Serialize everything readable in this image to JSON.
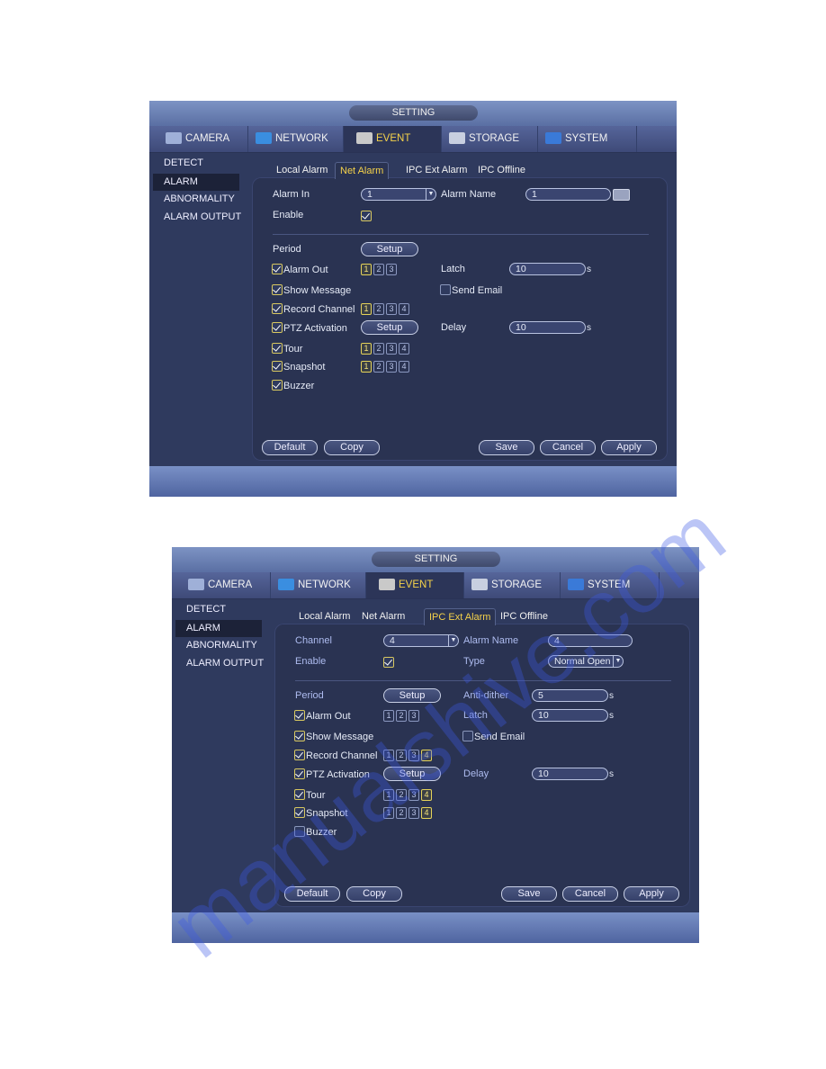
{
  "watermark": "manualshive.com",
  "colors": {
    "accent": "#f5d24a",
    "background": "#2f3a5e",
    "checkbox": "#d8c860"
  },
  "panels": [
    {
      "title": "SETTING",
      "tabs": [
        {
          "label": "CAMERA",
          "icon": "camera-icon"
        },
        {
          "label": "NETWORK",
          "icon": "network-icon"
        },
        {
          "label": "EVENT",
          "icon": "event-icon",
          "active": true
        },
        {
          "label": "STORAGE",
          "icon": "storage-icon"
        },
        {
          "label": "SYSTEM",
          "icon": "system-icon"
        }
      ],
      "sidebar": [
        {
          "label": "DETECT"
        },
        {
          "label": "ALARM",
          "active": true
        },
        {
          "label": "ABNORMALITY"
        },
        {
          "label": "ALARM OUTPUT"
        }
      ],
      "subtabs": [
        {
          "label": "Local Alarm"
        },
        {
          "label": "Net Alarm",
          "active": true
        },
        {
          "label": "IPC Ext Alarm"
        },
        {
          "label": "IPC Offline"
        }
      ],
      "rows": [
        {
          "left": {
            "label": "Alarm In",
            "control": {
              "kind": "select",
              "value": "1"
            }
          },
          "right": {
            "label": "Alarm Name",
            "control": {
              "kind": "input-icon",
              "value": "1"
            }
          }
        },
        {
          "left": {
            "label": "Enable",
            "control": {
              "kind": "checkbox",
              "checked": true
            }
          }
        },
        {
          "left": {
            "label": "Period",
            "control": {
              "kind": "button",
              "label": "Setup"
            }
          }
        },
        {
          "left": {
            "label": "Alarm Out",
            "checked": true,
            "control": {
              "kind": "channels",
              "items": [
                {
                  "n": "1",
                  "on": true
                },
                {
                  "n": "2"
                },
                {
                  "n": "3"
                }
              ]
            }
          },
          "right": {
            "label": "Latch",
            "control": {
              "kind": "input",
              "value": "10",
              "unit": "s"
            }
          }
        },
        {
          "left": {
            "label": "Show Message",
            "checked": true
          },
          "right": {
            "label": "Send Email",
            "checked": false
          }
        },
        {
          "left": {
            "label": "Record Channel",
            "checked": true,
            "control": {
              "kind": "channels",
              "items": [
                {
                  "n": "1",
                  "on": true
                },
                {
                  "n": "2"
                },
                {
                  "n": "3"
                },
                {
                  "n": "4"
                }
              ]
            }
          }
        },
        {
          "left": {
            "label": "PTZ Activation",
            "checked": true,
            "control": {
              "kind": "button",
              "label": "Setup"
            }
          },
          "right": {
            "label": "Delay",
            "control": {
              "kind": "input",
              "value": "10",
              "unit": "s"
            }
          }
        },
        {
          "left": {
            "label": "Tour",
            "checked": true,
            "control": {
              "kind": "channels",
              "items": [
                {
                  "n": "1",
                  "on": true
                },
                {
                  "n": "2"
                },
                {
                  "n": "3"
                },
                {
                  "n": "4"
                }
              ]
            }
          }
        },
        {
          "left": {
            "label": "Snapshot",
            "checked": true,
            "control": {
              "kind": "channels",
              "items": [
                {
                  "n": "1",
                  "on": true
                },
                {
                  "n": "2"
                },
                {
                  "n": "3"
                },
                {
                  "n": "4"
                }
              ]
            }
          }
        },
        {
          "left": {
            "label": "Buzzer",
            "checked": true
          }
        }
      ],
      "buttons": {
        "default": "Default",
        "copy": "Copy",
        "save": "Save",
        "cancel": "Cancel",
        "apply": "Apply"
      }
    },
    {
      "title": "SETTING",
      "tabs": [
        {
          "label": "CAMERA",
          "icon": "camera-icon"
        },
        {
          "label": "NETWORK",
          "icon": "network-icon"
        },
        {
          "label": "EVENT",
          "icon": "event-icon",
          "active": true
        },
        {
          "label": "STORAGE",
          "icon": "storage-icon"
        },
        {
          "label": "SYSTEM",
          "icon": "system-icon"
        }
      ],
      "sidebar": [
        {
          "label": "DETECT"
        },
        {
          "label": "ALARM",
          "active": true
        },
        {
          "label": "ABNORMALITY"
        },
        {
          "label": "ALARM OUTPUT"
        }
      ],
      "subtabs": [
        {
          "label": "Local Alarm"
        },
        {
          "label": "Net Alarm"
        },
        {
          "label": "IPC Ext Alarm",
          "active": true
        },
        {
          "label": "IPC Offline"
        }
      ],
      "rows": [
        {
          "left": {
            "label": "Channel",
            "control": {
              "kind": "select",
              "value": "4"
            }
          },
          "right": {
            "label": "Alarm Name",
            "control": {
              "kind": "input-wide",
              "value": "4"
            }
          }
        },
        {
          "left": {
            "label": "Enable",
            "control": {
              "kind": "checkbox",
              "checked": true
            }
          },
          "right": {
            "label": "Type",
            "control": {
              "kind": "select",
              "value": "Normal Open"
            }
          }
        },
        {
          "left": {
            "label": "Period",
            "control": {
              "kind": "button",
              "label": "Setup"
            }
          },
          "right": {
            "label": "Anti-dither",
            "control": {
              "kind": "input",
              "value": "5",
              "unit": "s"
            }
          }
        },
        {
          "left": {
            "label": "Alarm Out",
            "checked": true,
            "control": {
              "kind": "channels",
              "items": [
                {
                  "n": "1"
                },
                {
                  "n": "2"
                },
                {
                  "n": "3"
                }
              ]
            }
          },
          "right": {
            "label": "Latch",
            "control": {
              "kind": "input",
              "value": "10",
              "unit": "s"
            }
          }
        },
        {
          "left": {
            "label": "Show Message",
            "checked": true
          },
          "right": {
            "label": "Send Email",
            "checked": false
          }
        },
        {
          "left": {
            "label": "Record Channel",
            "checked": true,
            "control": {
              "kind": "channels",
              "items": [
                {
                  "n": "1"
                },
                {
                  "n": "2"
                },
                {
                  "n": "3"
                },
                {
                  "n": "4",
                  "on": true
                }
              ]
            }
          }
        },
        {
          "left": {
            "label": "PTZ Activation",
            "checked": true,
            "control": {
              "kind": "button",
              "label": "Setup"
            }
          },
          "right": {
            "label": "Delay",
            "control": {
              "kind": "input",
              "value": "10",
              "unit": "s"
            }
          }
        },
        {
          "left": {
            "label": "Tour",
            "checked": true,
            "control": {
              "kind": "channels",
              "items": [
                {
                  "n": "1"
                },
                {
                  "n": "2"
                },
                {
                  "n": "3"
                },
                {
                  "n": "4",
                  "on": true
                }
              ]
            }
          }
        },
        {
          "left": {
            "label": "Snapshot",
            "checked": true,
            "control": {
              "kind": "channels",
              "items": [
                {
                  "n": "1"
                },
                {
                  "n": "2"
                },
                {
                  "n": "3"
                },
                {
                  "n": "4",
                  "on": true
                }
              ]
            }
          }
        },
        {
          "left": {
            "label": "Buzzer",
            "checked": false
          }
        }
      ],
      "buttons": {
        "default": "Default",
        "copy": "Copy",
        "save": "Save",
        "cancel": "Cancel",
        "apply": "Apply"
      }
    }
  ]
}
